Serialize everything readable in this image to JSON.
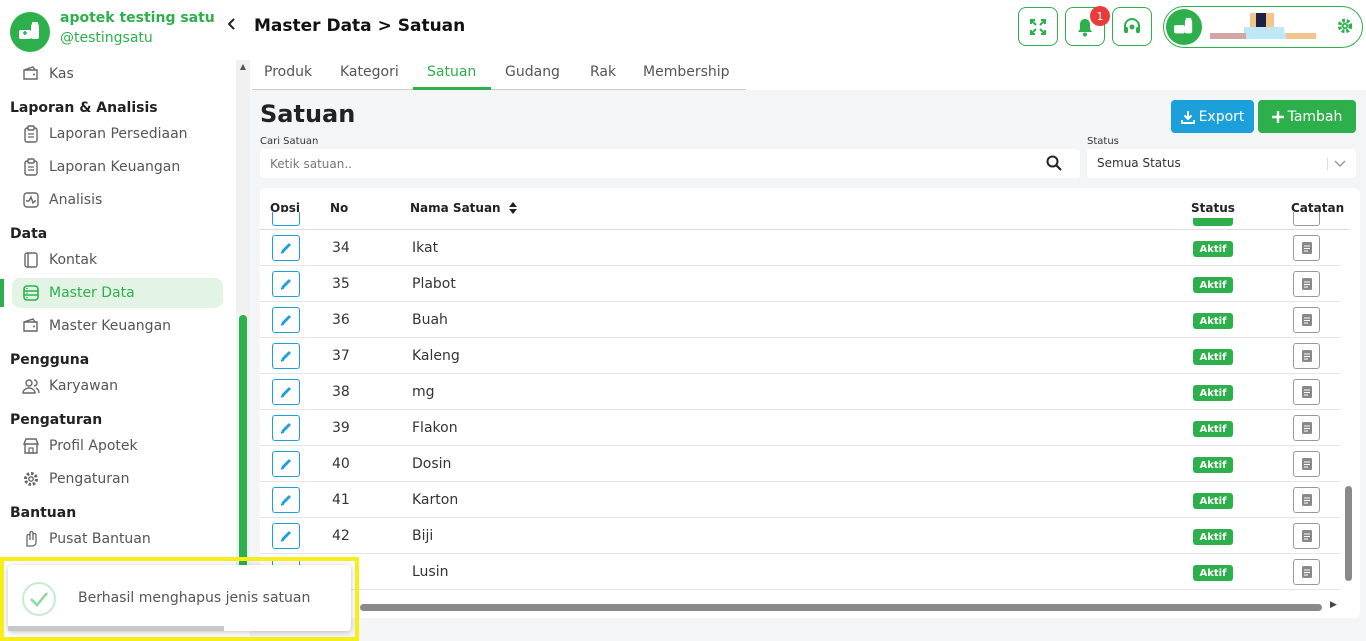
{
  "brand": {
    "name": "apotek testing satu",
    "username": "@testingsatu"
  },
  "sidebar": {
    "items": [
      {
        "label": "Kas",
        "icon": "wallet-icon"
      },
      {
        "section": "Laporan & Analisis"
      },
      {
        "label": "Laporan Persediaan",
        "icon": "clipboard-icon"
      },
      {
        "label": "Laporan Keuangan",
        "icon": "clipboard-icon"
      },
      {
        "label": "Analisis",
        "icon": "chart-pulse-icon"
      },
      {
        "section": "Data"
      },
      {
        "label": "Kontak",
        "icon": "contact-book-icon"
      },
      {
        "label": "Master Data",
        "icon": "database-icon",
        "active": true
      },
      {
        "label": "Master Keuangan",
        "icon": "wallet-icon"
      },
      {
        "section": "Pengguna"
      },
      {
        "label": "Karyawan",
        "icon": "users-icon"
      },
      {
        "section": "Pengaturan"
      },
      {
        "label": "Profil Apotek",
        "icon": "store-icon"
      },
      {
        "label": "Pengaturan",
        "icon": "gear-icon"
      },
      {
        "section": "Bantuan"
      },
      {
        "label": "Pusat Bantuan",
        "icon": "hand-icon"
      }
    ]
  },
  "header": {
    "breadcrumb": "Master Data > Satuan",
    "notification_count": "1"
  },
  "tabs": [
    "Produk",
    "Kategori",
    "Satuan",
    "Gudang",
    "Rak",
    "Membership"
  ],
  "active_tab": "Satuan",
  "main": {
    "title": "Satuan",
    "export_label": "Export",
    "add_label": "Tambah",
    "search_label": "Cari Satuan",
    "search_placeholder": "Ketik satuan..",
    "status_label": "Status",
    "status_value": "Semua Status"
  },
  "table": {
    "columns": [
      "Opsi",
      "No",
      "Nama Satuan",
      "Status",
      "Catatan"
    ],
    "rows": [
      {
        "no": "34",
        "name": "Ikat",
        "status": "Aktif"
      },
      {
        "no": "35",
        "name": "Plabot",
        "status": "Aktif"
      },
      {
        "no": "36",
        "name": "Buah",
        "status": "Aktif"
      },
      {
        "no": "37",
        "name": "Kaleng",
        "status": "Aktif"
      },
      {
        "no": "38",
        "name": "mg",
        "status": "Aktif"
      },
      {
        "no": "39",
        "name": "Flakon",
        "status": "Aktif"
      },
      {
        "no": "40",
        "name": "Dosin",
        "status": "Aktif"
      },
      {
        "no": "41",
        "name": "Karton",
        "status": "Aktif"
      },
      {
        "no": "42",
        "name": "Biji",
        "status": "Aktif"
      },
      {
        "no": "",
        "name": "Lusin",
        "status": "Aktif"
      }
    ]
  },
  "toast": {
    "message": "Berhasil menghapus jenis satuan"
  },
  "colors": {
    "primary": "#2db04b",
    "info": "#1ba0dc",
    "danger": "#ea3b3b",
    "highlight": "#f5ee1a"
  }
}
